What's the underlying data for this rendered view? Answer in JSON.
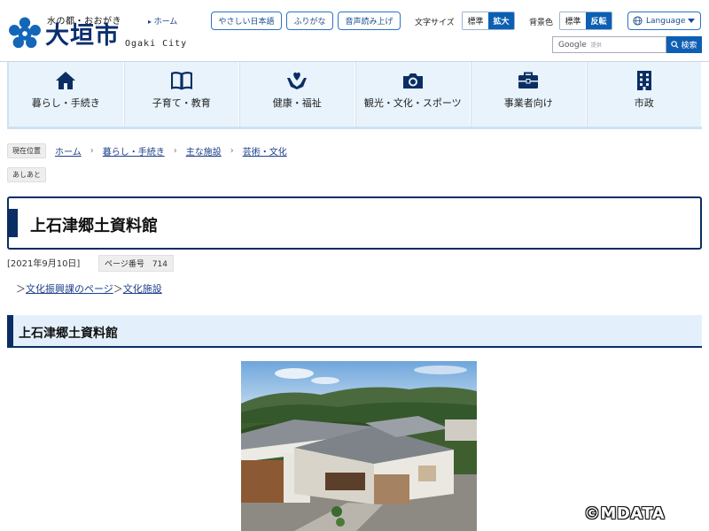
{
  "header": {
    "tagline": "水の都・おおがき",
    "city_name": "大垣市",
    "city_name_en": "Ogaki City",
    "home_link": "ホーム",
    "easy_japanese": "やさしい日本語",
    "furigana": "ふりがな",
    "read_aloud": "音声読み上げ",
    "font_size_label": "文字サイズ",
    "font_size_options": [
      "標準",
      "拡大"
    ],
    "font_size_selected": "拡大",
    "bg_color_label": "背景色",
    "bg_color_options": [
      "標準",
      "反転"
    ],
    "bg_color_selected": "反転",
    "language": "Language",
    "search_placeholder_brand": "Google",
    "search_placeholder_note": "提供",
    "search_button": "検索",
    "colors": {
      "brand": "#0a2e63",
      "accent": "#0d5fb3",
      "nav_bg": "#e8f3fc"
    }
  },
  "nav": {
    "items": [
      {
        "label": "暮らし・手続き",
        "icon": "house-icon"
      },
      {
        "label": "子育て・教育",
        "icon": "book-icon"
      },
      {
        "label": "健康・福祉",
        "icon": "hands-heart-icon"
      },
      {
        "label": "観光・文化・スポーツ",
        "icon": "camera-icon"
      },
      {
        "label": "事業者向け",
        "icon": "briefcase-icon"
      },
      {
        "label": "市政",
        "icon": "building-icon"
      }
    ]
  },
  "breadcrumb": {
    "label": "現在位置",
    "items": [
      "ホーム",
      "暮らし・手続き",
      "主な施設",
      "芸術・文化"
    ],
    "ashiato": "あしあと"
  },
  "page": {
    "title": "上石津郷土資料館",
    "date": "[2021年9月10日]",
    "page_number": "ページ番号　714",
    "links": [
      "文化振興課のページ",
      "文化施設"
    ],
    "section_title": "上石津郷土資料館"
  },
  "watermark": "©MDATA"
}
